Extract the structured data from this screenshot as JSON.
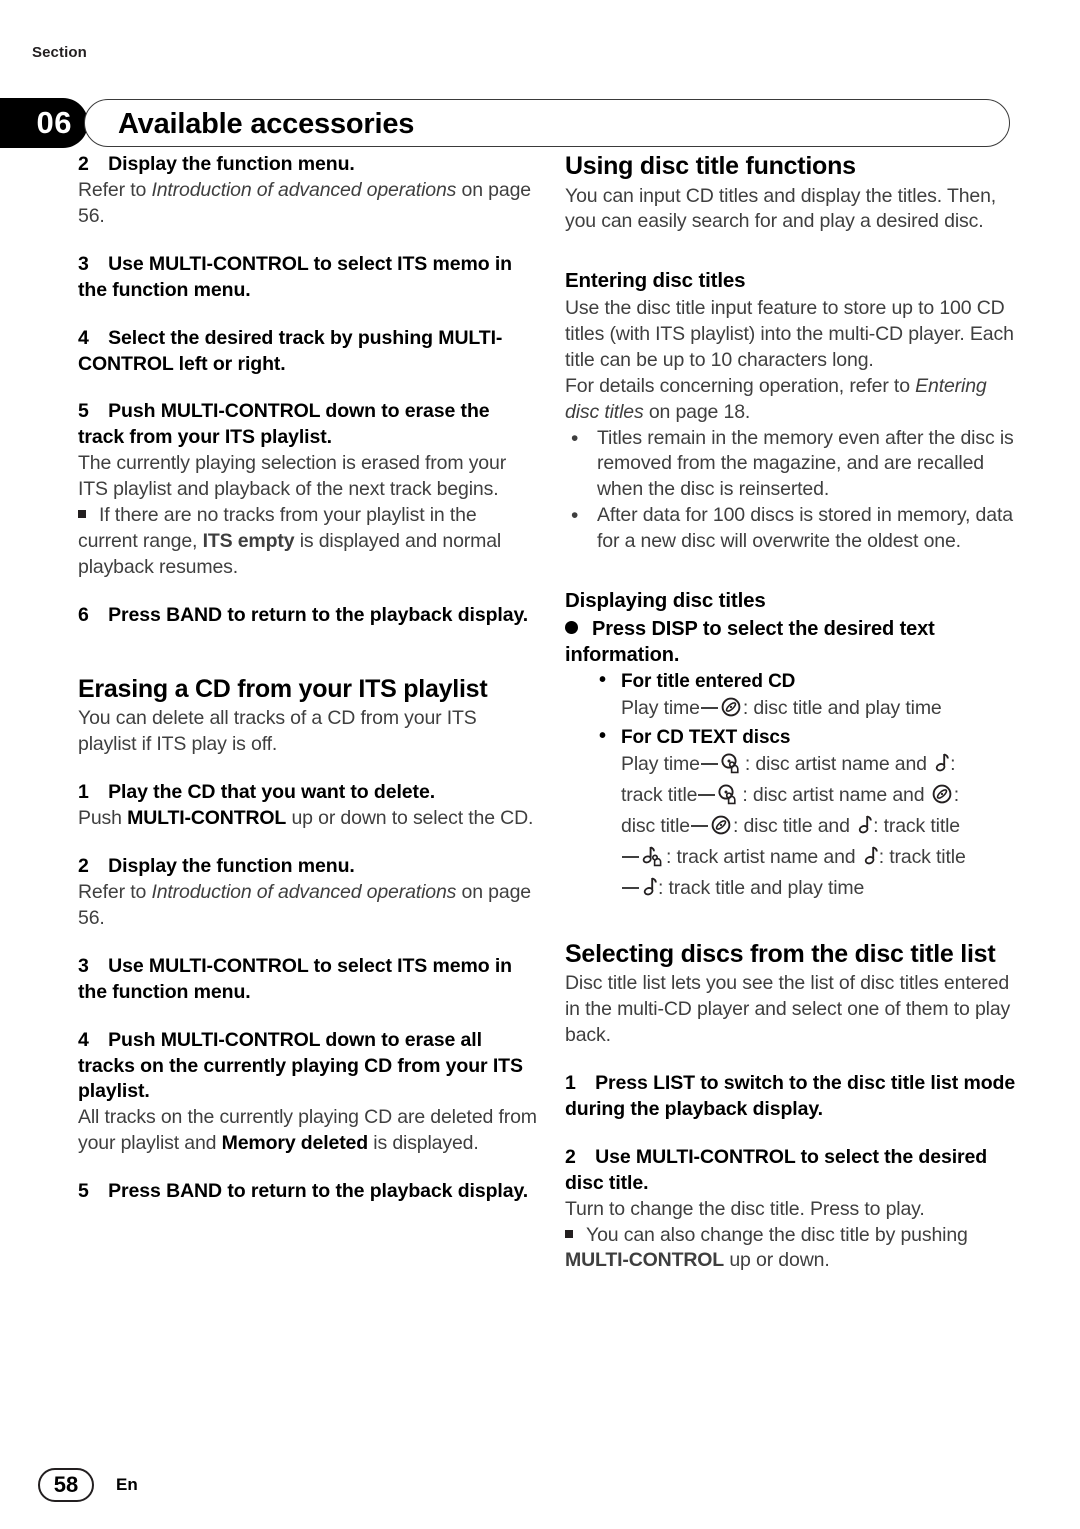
{
  "header": {
    "section_label": "Section",
    "section_number": "06",
    "title": "Available accessories"
  },
  "footer": {
    "page_number": "58",
    "language": "En"
  },
  "left_column": {
    "step2_title": "2 Display the function menu.",
    "step2_body_pre": "Refer to ",
    "step2_body_italic": "Introduction of advanced operations",
    "step2_body_post": " on page 56.",
    "step3_title": "3 Use MULTI-CONTROL to select ITS memo in the function menu.",
    "step4_title": "4 Select the desired track by pushing MULTI-CONTROL left or right.",
    "step5_title": "5 Push MULTI-CONTROL down to erase the track from your ITS playlist.",
    "step5_body": "The currently playing selection is erased from your ITS playlist and playback of the next track begins.",
    "note1_pre": "If there are no tracks from your playlist in the current range, ",
    "note1_bold": "ITS empty",
    "note1_post": " is displayed and normal playback resumes.",
    "step6_title": "6 Press BAND to return to the playback display.",
    "heading_erasing_cd": "Erasing a CD from your ITS playlist",
    "erasing_intro": "You can delete all tracks of a CD from your ITS playlist if ITS play is off.",
    "e_step1_title": "1 Play the CD that you want to delete.",
    "e_step1_body_pre": "Push ",
    "e_step1_body_bold": "MULTI-CONTROL",
    "e_step1_body_post": " up or down to select the CD.",
    "e_step2_title": "2 Display the function menu.",
    "e_step2_body_pre": "Refer to ",
    "e_step2_body_italic": "Introduction of advanced operations",
    "e_step2_body_post": " on page 56.",
    "e_step3_title": "3 Use MULTI-CONTROL to select ITS memo in the function menu.",
    "e_step4_title": "4 Push MULTI-CONTROL down to erase all tracks on the currently playing CD from your ITS playlist.",
    "e_step4_body_pre": "All tracks on the currently playing CD are deleted from your playlist and ",
    "e_step4_body_bold": "Memory deleted",
    "e_step4_body_post": " is displayed.",
    "e_step5_title": "5 Press BAND to return to the playback display."
  },
  "right_column": {
    "heading_using_disc_title": "Using disc title functions",
    "using_intro": "You can input CD titles and display the titles. Then, you can easily search for and play a desired disc.",
    "heading_entering": "Entering disc titles",
    "entering_body1": "Use the disc title input feature to store up to 100 CD titles  (with ITS playlist) into the multi-CD player. Each title can be up to 10 characters long.",
    "entering_body2_pre": "For details concerning operation, refer to ",
    "entering_body2_italic": "Entering disc titles",
    "entering_body2_post": " on page 18.",
    "entering_bullets": [
      "Titles remain in the memory even after the disc is removed from the magazine, and are recalled when the disc is reinserted.",
      "After data for 100 discs is stored in memory, data for a new disc will overwrite the oldest one."
    ],
    "heading_displaying": "Displaying disc titles",
    "displaying_lead": "Press DISP to select the desired text information.",
    "sub1_head_pre": "For title entered ",
    "sub1_head_bold": "CD",
    "sub1_line_a": "Play time",
    "sub1_line_b": ": disc title and play time",
    "sub2_head_pre": "For ",
    "sub2_head_bold": "CD TEXT",
    "sub2_head_post": " discs",
    "text_play_time": "Play time",
    "text_track_title_lbl": "track title",
    "text_disc_title_lbl": "disc title",
    "t_disc_artist_and": ": disc artist name and ",
    "t_colon": ":",
    "t_disc_title_and": ": disc title and ",
    "t_track_title": ": track title",
    "t_track_artist_and": ": track artist name and ",
    "t_track_title_playtime": ": track title and play time",
    "heading_selecting": "Selecting discs from the disc title list",
    "selecting_intro": "Disc title list lets you see the list of disc titles entered in the multi-CD player and select one of them to play back.",
    "s_step1_title": "1 Press LIST to switch to the disc title list mode during the playback display.",
    "s_step2_title": "2 Use MULTI-CONTROL to select the desired disc title.",
    "s_step2_body": "Turn to change the disc title. Press to play.",
    "s_note_pre": "You can also change the disc title by pushing ",
    "s_note_bold": "MULTI-CONTROL",
    "s_note_post": " up or down."
  },
  "icons": {
    "disc": "disc-icon",
    "disc_artist": "disc-artist-icon",
    "music_note": "music-note-icon",
    "track_artist": "track-artist-icon"
  }
}
